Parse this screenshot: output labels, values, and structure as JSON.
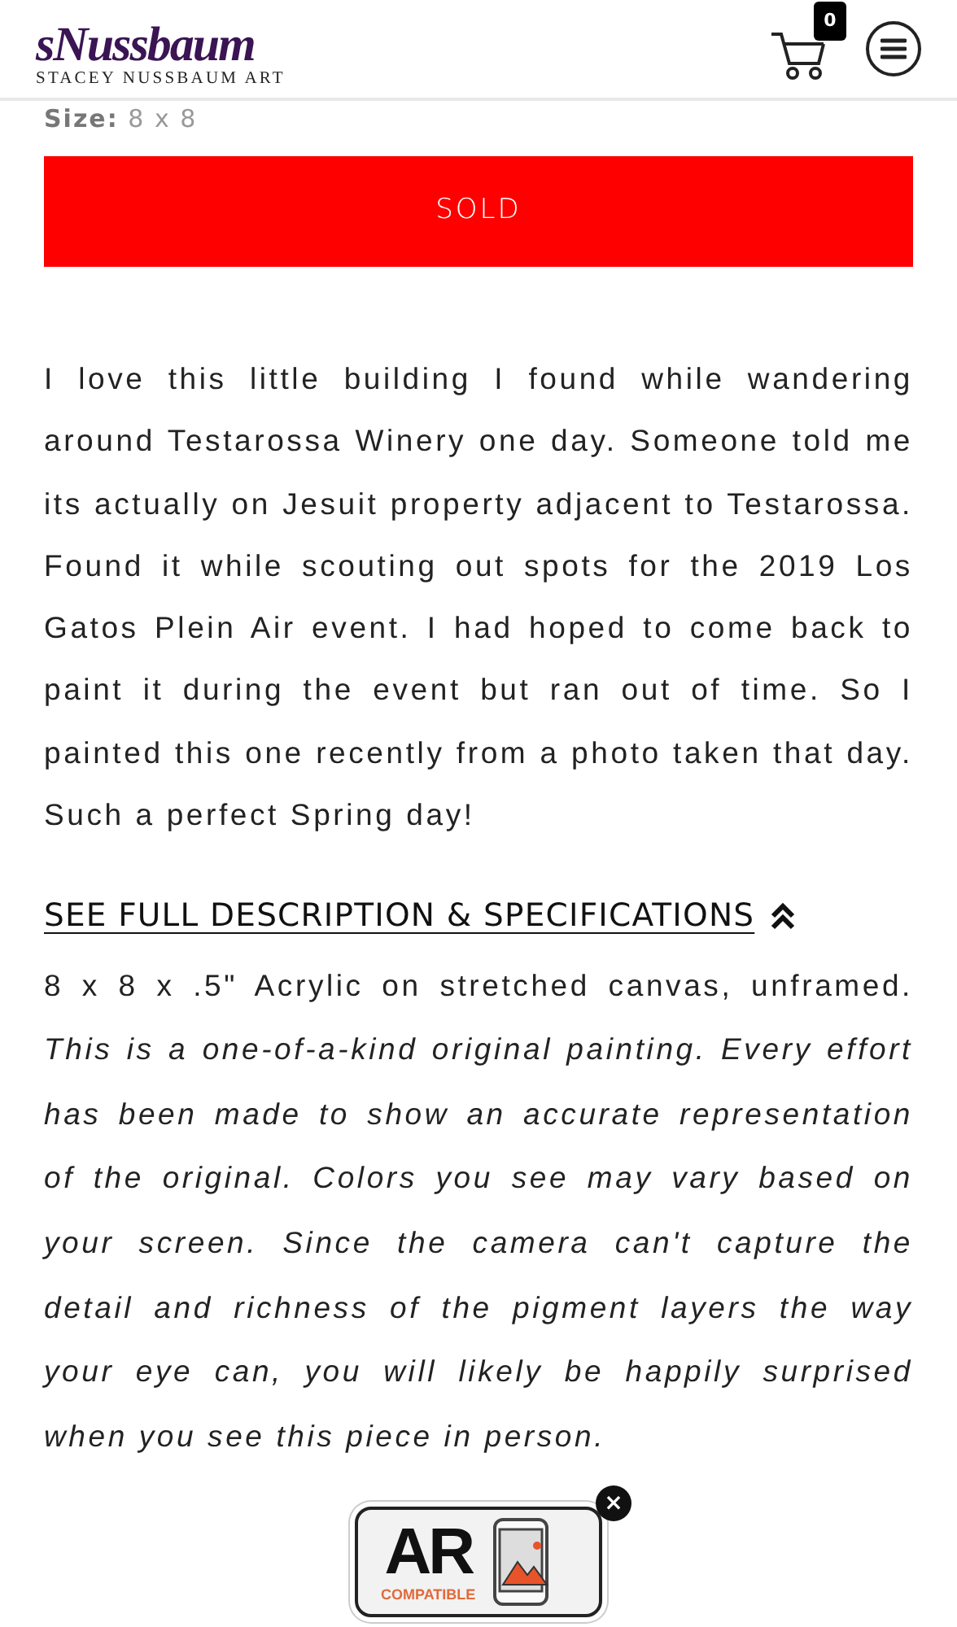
{
  "header": {
    "logo_script": "sNussbaum",
    "logo_tagline": "STACEY NUSSBAUM ART",
    "cart_count": "0"
  },
  "size": {
    "label": "Size:",
    "value": "8 x 8"
  },
  "status_button": {
    "label": "SOLD"
  },
  "description": "I love this little building I found while wandering around Testarossa Winery one day. Someone told me its actually on Jesuit property adjacent to Testarossa. Found it while scouting out spots for the 2019 Los Gatos Plein Air event. I had hoped to come back to paint it during the event but ran out of time. So I painted this one recently from a photo taken that day. Such a perfect Spring day!",
  "details_toggle": {
    "label": "SEE FULL DESCRIPTION & SPECIFICATIONS",
    "expanded": true
  },
  "specifications": "8 x 8 x .5\" Acrylic on stretched canvas, unframed. *This is a one-of-a-kind original painting. Every effort has been made to show an accurate representation of the original. Colors you see may vary based on your screen. Since the camera can't capture the detail and richness of the pigment layers the way your eye can, you will likely be happily surprised when you see this piece in person.*",
  "ar_badge": {
    "title": "AR",
    "subtitle": "COMPATIBLE",
    "close": "×"
  }
}
